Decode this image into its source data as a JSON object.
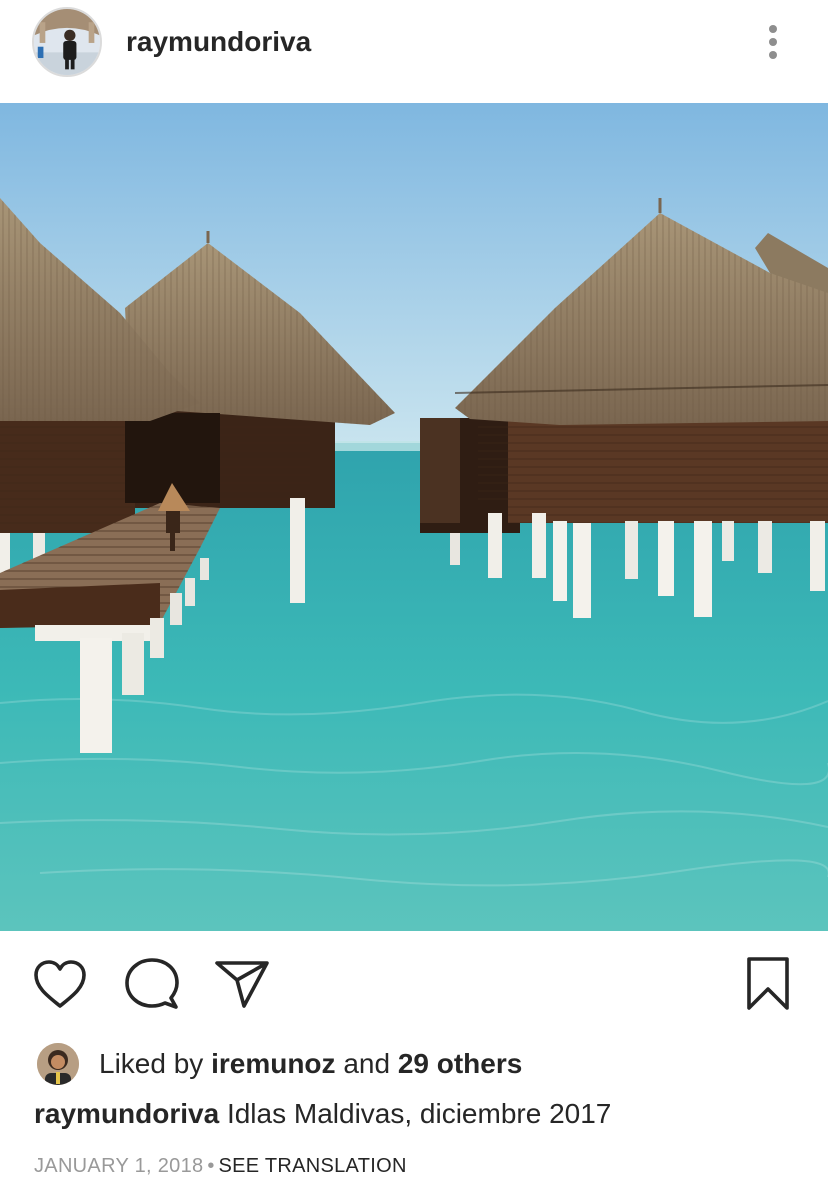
{
  "post": {
    "username": "raymundoriva",
    "photo_alt": "Overwater bungalows with thatched roofs above turquoise water",
    "liked_by_prefix": "Liked by",
    "liked_by_user": "iremunoz",
    "liked_by_and": "and",
    "liked_by_others": "29 others",
    "caption_user": "raymundoriva",
    "caption_text": "Idlas Maldivas, diciembre 2017",
    "date": "JANUARY 1, 2018",
    "separator": "•",
    "see_translation": "SEE TRANSLATION"
  },
  "icons": {
    "more": "more-vertical-icon",
    "like": "heart-icon",
    "comment": "comment-icon",
    "share": "send-icon",
    "save": "bookmark-icon"
  },
  "colors": {
    "text": "#262626",
    "secondary": "#999999",
    "sky": "#8fc3e2",
    "water": "#3fb2b0"
  }
}
